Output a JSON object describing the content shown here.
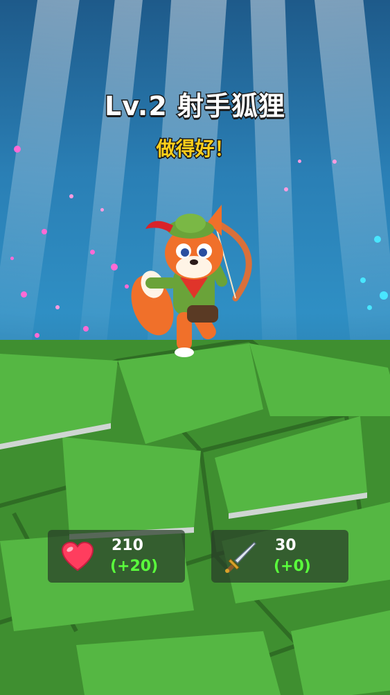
{
  "level_up": {
    "title": "Lv.2 射手狐狸",
    "subtitle": "做得好！"
  },
  "stats": {
    "health": {
      "icon": "heart-icon",
      "value": "210",
      "bonus": "(+20)"
    },
    "attack": {
      "icon": "sword-icon",
      "value": "30",
      "bonus": "(+0)"
    }
  },
  "colors": {
    "title_text": "#ffffff",
    "subtitle_text": "#ffcf1a",
    "bonus_text": "#5aff3c",
    "grass": "#4caf3a"
  }
}
